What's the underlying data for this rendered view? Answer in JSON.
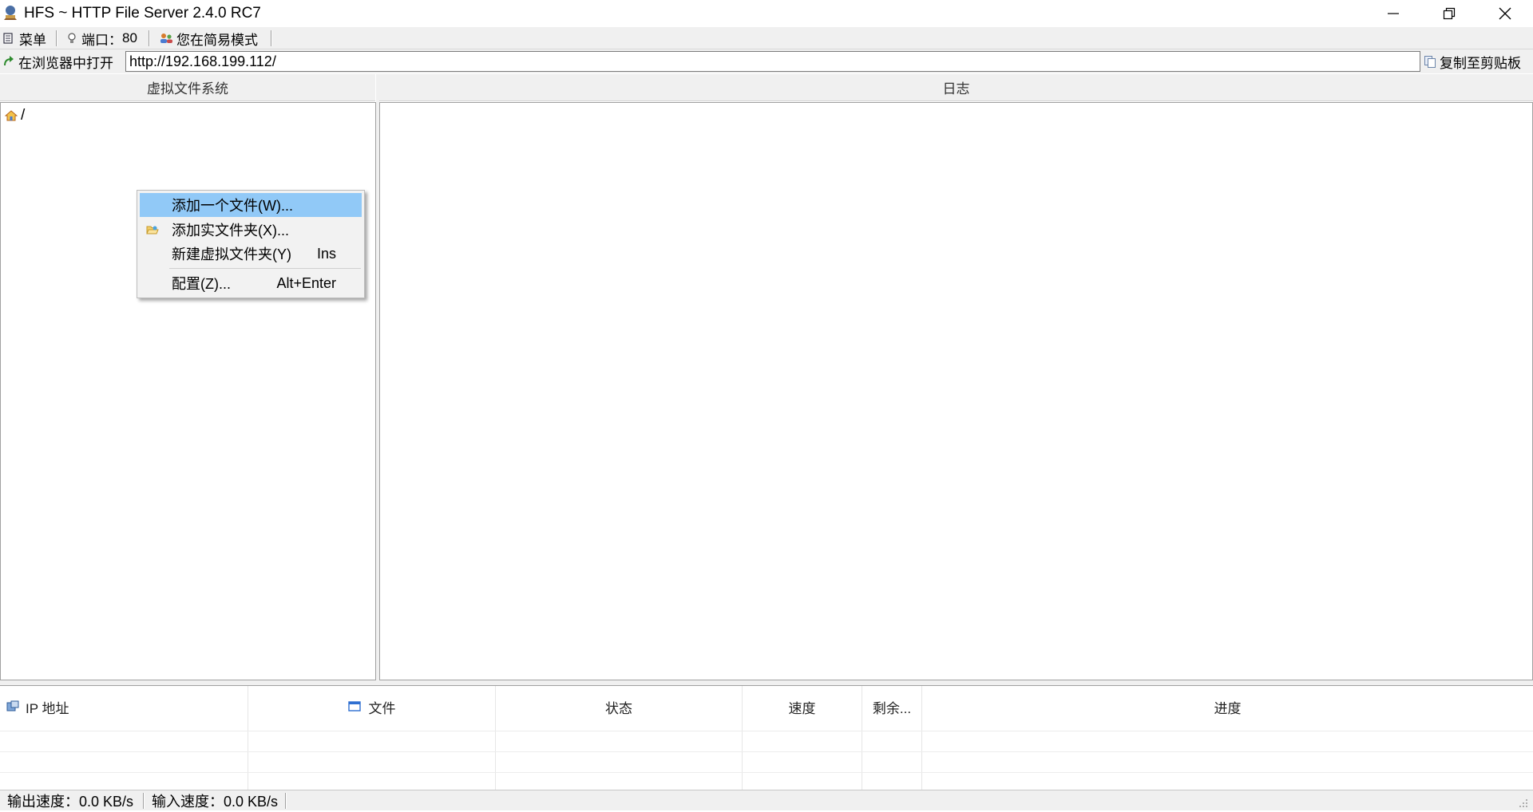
{
  "window": {
    "title": "HFS ~ HTTP File Server 2.4.0 RC7"
  },
  "toolbar": {
    "menu_label": "菜单",
    "port_label": "端口：",
    "port_value": "80",
    "mode_label": "您在简易模式"
  },
  "urlbar": {
    "open_in_browser_label": "在浏览器中打开",
    "url_value": "http://192.168.199.112/",
    "copy_label": "复制至剪贴板"
  },
  "vfs": {
    "header": "虚拟文件系统",
    "root_label": "/"
  },
  "log": {
    "header": "日志"
  },
  "context_menu": {
    "items": [
      {
        "label": "添加一个文件(W)...",
        "shortcut": "",
        "highlighted": true
      },
      {
        "label": "添加实文件夹(X)...",
        "shortcut": "",
        "icon": "folder-open-icon"
      },
      {
        "label": "新建虚拟文件夹(Y)",
        "shortcut": "Ins"
      },
      {
        "label": "配置(Z)...",
        "shortcut": "Alt+Enter"
      }
    ]
  },
  "connections": {
    "columns": [
      "IP 地址",
      "文件",
      "状态",
      "速度",
      "剩余...",
      "进度"
    ]
  },
  "statusbar": {
    "out_speed": "输出速度：0.0 KB/s",
    "in_speed": "输入速度：0.0 KB/s"
  },
  "colors": {
    "menu_highlight": "#91c9f7",
    "chrome_bg": "#f0f0f0"
  }
}
